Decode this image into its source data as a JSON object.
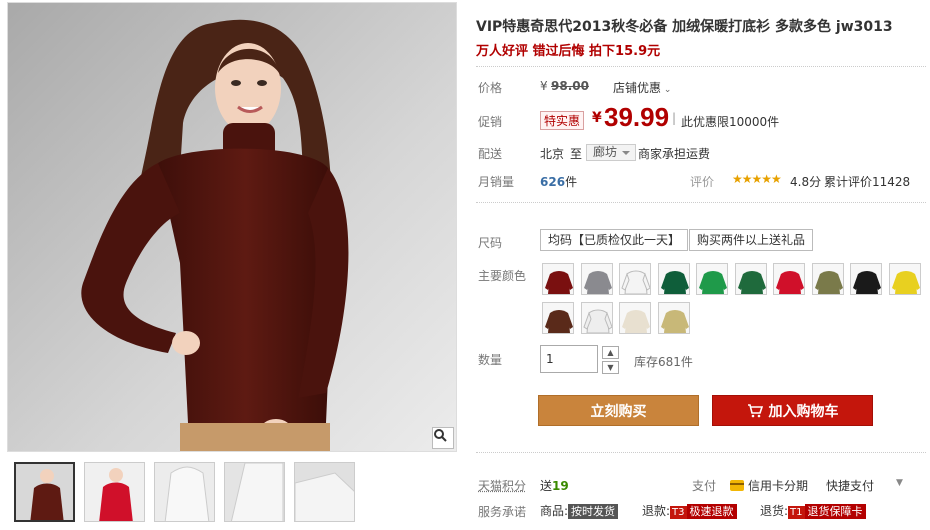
{
  "product": {
    "title": "VIP特惠奇思代2013秋冬必备 加绒保暖打底衫 多款多色 jw3013",
    "subtitle": "万人好评 错过后悔 拍下15.9元"
  },
  "price": {
    "label": "价格",
    "currency": "¥",
    "original": "98.00",
    "store_discount": "店铺优惠"
  },
  "promo": {
    "label": "促销",
    "badge": "特实惠",
    "currency": "¥",
    "price": "39.99",
    "limit": "此优惠限10000件"
  },
  "shipping": {
    "label": "配送",
    "from": "北京",
    "to_word": "至",
    "to": "廊坊",
    "note": "商家承担运费"
  },
  "sales": {
    "label": "月销量",
    "count": "626",
    "unit": "件",
    "rating_label": "评价",
    "stars": "★★★★★",
    "score": "4.8分",
    "reviews": "累计评价11428"
  },
  "size": {
    "label": "尺码",
    "options": [
      "均码【已质检仅此一天】",
      "购买两件以上送礼品"
    ]
  },
  "colors": {
    "label": "主要颜色",
    "swatches": [
      "#7a1010",
      "#8a8a8f",
      "#f4f4f4",
      "#0f5e3a",
      "#1f9a4a",
      "#1f6a3c",
      "#d0102a",
      "#7a7a4a",
      "#1a1a1a",
      "#e8d020",
      "#5a2a1a",
      "#eeeeee",
      "#e8e0d0",
      "#c8b878"
    ]
  },
  "quantity": {
    "label": "数量",
    "value": "1",
    "stock": "库存681件"
  },
  "actions": {
    "buy": "立刻购买",
    "cart": "加入购物车"
  },
  "points": {
    "label": "天猫积分",
    "give": "送",
    "value": "19",
    "pay_label": "支付",
    "credit": "信用卡分期",
    "quick": "快捷支付"
  },
  "service": {
    "label": "服务承诺",
    "goods": "商品:",
    "goods_tag": "按时发货",
    "refund": "退款:",
    "refund_code": "T3",
    "refund_tag": "极速退款",
    "return": "退货:",
    "return_code": "T1",
    "return_tag": "退货保障卡"
  },
  "colors_theme": {
    "accent_red": "#b10000",
    "buy_orange": "#c9843c",
    "cart_red": "#c4160c",
    "sweater_brown": "#5e1a12"
  }
}
